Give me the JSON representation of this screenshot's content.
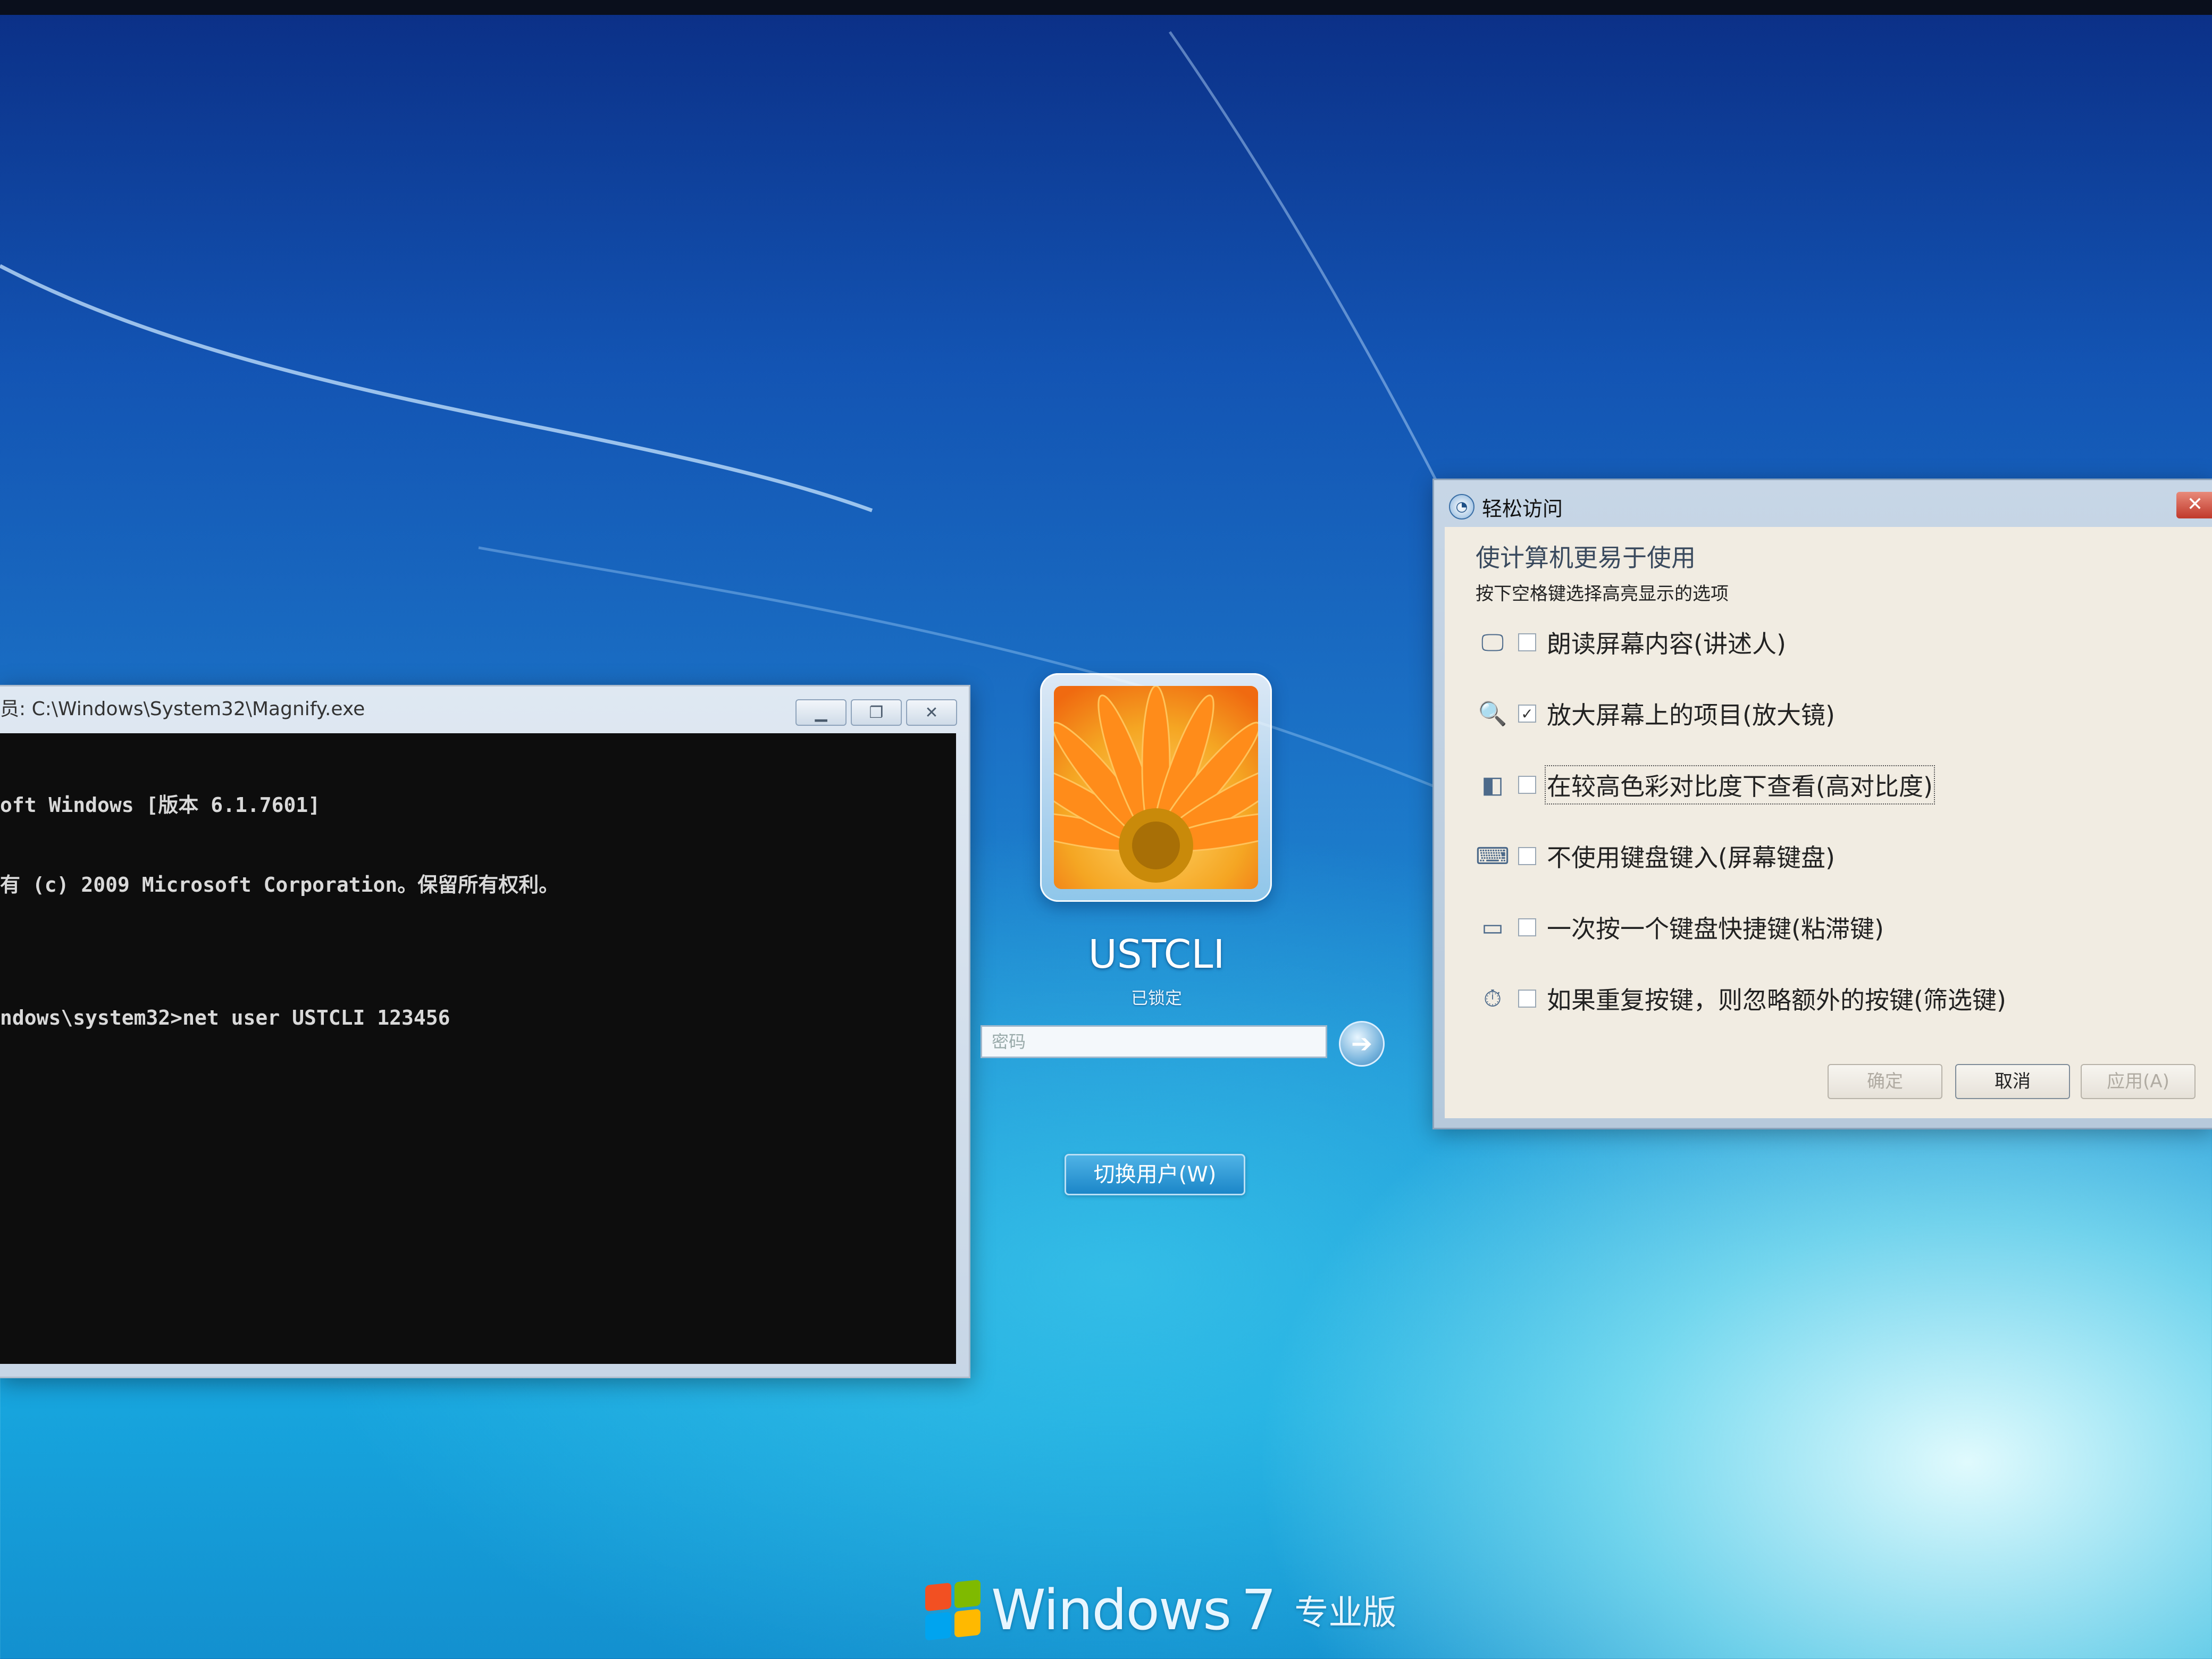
{
  "console": {
    "title": "员: C:\\Windows\\System32\\Magnify.exe",
    "lines": [
      "oft Windows [版本 6.1.7601]",
      "有 (c) 2009 Microsoft Corporation。保留所有权利。",
      "",
      "ndows\\system32>net user USTCLI 123456"
    ],
    "buttons": {
      "minimize": "▁",
      "restore": "❐",
      "close": "✕"
    }
  },
  "logon": {
    "username": "USTCLI",
    "status": "已锁定",
    "password_placeholder": "密码",
    "go_arrow": "➔",
    "switch_user": "切换用户(W)"
  },
  "ease": {
    "title": "轻松访问",
    "close": "✕",
    "heading": "使计算机更易于使用",
    "subheading": "按下空格键选择高亮显示的选项",
    "options": [
      {
        "label": "朗读屏幕内容(讲述人)",
        "checked": false,
        "icon": "narrator-icon",
        "glyph": "🖵"
      },
      {
        "label": "放大屏幕上的项目(放大镜)",
        "checked": true,
        "icon": "magnifier-icon",
        "glyph": "🔍"
      },
      {
        "label": "在较高色彩对比度下查看(高对比度)",
        "checked": false,
        "icon": "high-contrast-icon",
        "glyph": "◧"
      },
      {
        "label": "不使用键盘键入(屏幕键盘)",
        "checked": false,
        "icon": "on-screen-keyboard-icon",
        "glyph": "⌨"
      },
      {
        "label": "一次按一个键盘快捷键(粘滞键)",
        "checked": false,
        "icon": "sticky-keys-icon",
        "glyph": "▭"
      },
      {
        "label": "如果重复按键，则忽略额外的按键(筛选键)",
        "checked": false,
        "icon": "filter-keys-icon",
        "glyph": "⏱"
      }
    ],
    "buttons": {
      "ok": "确定",
      "cancel": "取消",
      "apply": "应用(A)"
    }
  },
  "brand": {
    "product": "Windows",
    "version": "7",
    "edition": "专业版"
  },
  "colors": {
    "console_bg": "#0d0d0d",
    "console_text": "#d9d9d9",
    "dialog_bg": "#f1ece2",
    "switch_button": "#1b86c8",
    "flag_red": "#f25022",
    "flag_green": "#7fba00",
    "flag_blue": "#00a4ef",
    "flag_yellow": "#ffb900"
  }
}
